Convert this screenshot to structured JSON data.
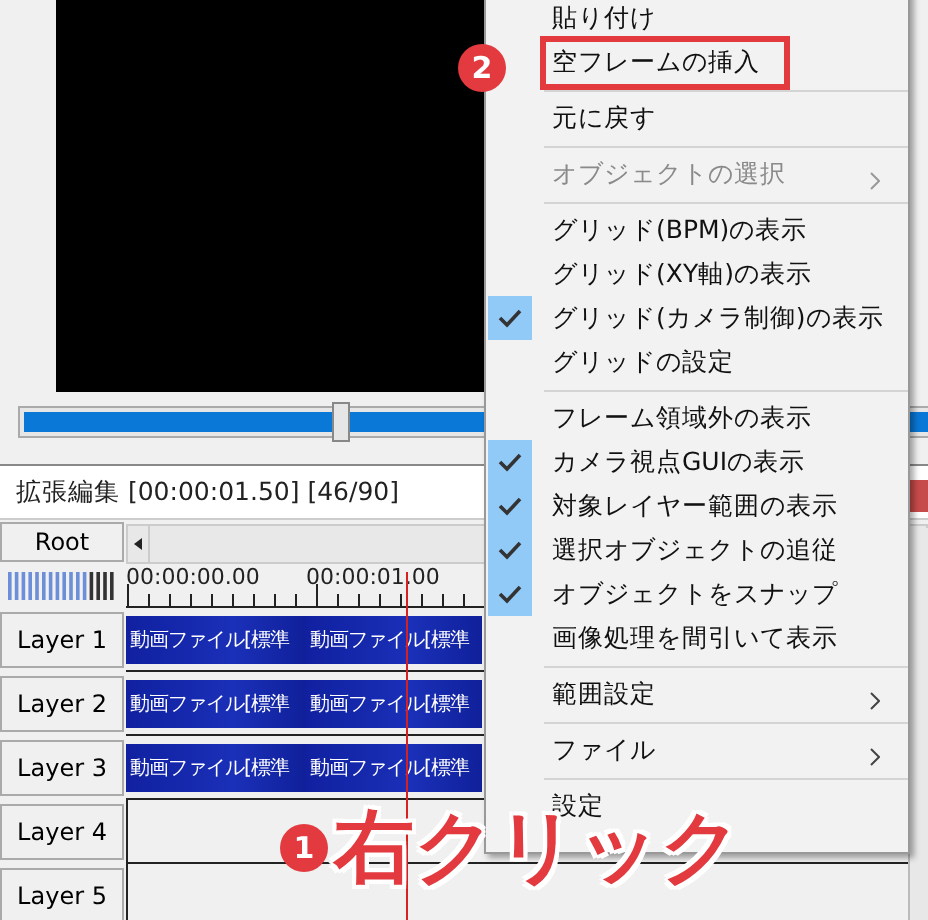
{
  "seek_slider": {
    "level": 0.35
  },
  "timeline": {
    "title": "拡張編集 [00:00:01.50] [46/90]",
    "root_button": "Root",
    "time_labels": [
      "00:00:00.00",
      "00:00:01.00"
    ],
    "layers": [
      {
        "name": "Layer 1",
        "clips": [
          "動画ファイル[標準",
          "動画ファイル[標準"
        ]
      },
      {
        "name": "Layer 2",
        "clips": [
          "動画ファイル[標準",
          "動画ファイル[標準"
        ]
      },
      {
        "name": "Layer 3",
        "clips": [
          "動画ファイル[標準",
          "動画ファイル[標準"
        ]
      },
      {
        "name": "Layer 4"
      },
      {
        "name": "Layer 5"
      }
    ]
  },
  "context_menu": {
    "items": [
      {
        "kind": "item",
        "label": "貼り付け",
        "checked": false,
        "disabled": false,
        "submenu": false,
        "highlighted": false
      },
      {
        "kind": "item",
        "label": "空フレームの挿入",
        "checked": false,
        "disabled": false,
        "submenu": false,
        "highlighted": true
      },
      {
        "kind": "separator"
      },
      {
        "kind": "item",
        "label": "元に戻す",
        "checked": false,
        "disabled": false,
        "submenu": false,
        "highlighted": false
      },
      {
        "kind": "separator"
      },
      {
        "kind": "item",
        "label": "オブジェクトの選択",
        "checked": false,
        "disabled": true,
        "submenu": true,
        "highlighted": false
      },
      {
        "kind": "separator"
      },
      {
        "kind": "item",
        "label": "グリッド(BPM)の表示",
        "checked": false,
        "disabled": false,
        "submenu": false,
        "highlighted": false
      },
      {
        "kind": "item",
        "label": "グリッド(XY軸)の表示",
        "checked": false,
        "disabled": false,
        "submenu": false,
        "highlighted": false
      },
      {
        "kind": "item",
        "label": "グリッド(カメラ制御)の表示",
        "checked": true,
        "disabled": false,
        "submenu": false,
        "highlighted": false
      },
      {
        "kind": "item",
        "label": "グリッドの設定",
        "checked": false,
        "disabled": false,
        "submenu": false,
        "highlighted": false
      },
      {
        "kind": "separator"
      },
      {
        "kind": "item",
        "label": "フレーム領域外の表示",
        "checked": false,
        "disabled": false,
        "submenu": false,
        "highlighted": false
      },
      {
        "kind": "item",
        "label": "カメラ視点GUIの表示",
        "checked": true,
        "disabled": false,
        "submenu": false,
        "highlighted": false
      },
      {
        "kind": "item",
        "label": "対象レイヤー範囲の表示",
        "checked": true,
        "disabled": false,
        "submenu": false,
        "highlighted": false
      },
      {
        "kind": "item",
        "label": "選択オブジェクトの追従",
        "checked": true,
        "disabled": false,
        "submenu": false,
        "highlighted": false
      },
      {
        "kind": "item",
        "label": "オブジェクトをスナップ",
        "checked": true,
        "disabled": false,
        "submenu": false,
        "highlighted": false
      },
      {
        "kind": "item",
        "label": "画像処理を間引いて表示",
        "checked": false,
        "disabled": false,
        "submenu": false,
        "highlighted": false
      },
      {
        "kind": "separator"
      },
      {
        "kind": "item",
        "label": "範囲設定",
        "checked": false,
        "disabled": false,
        "submenu": true,
        "highlighted": false
      },
      {
        "kind": "separator"
      },
      {
        "kind": "item",
        "label": "ファイル",
        "checked": false,
        "disabled": false,
        "submenu": true,
        "highlighted": false
      },
      {
        "kind": "separator"
      },
      {
        "kind": "item",
        "label": "設定",
        "checked": false,
        "disabled": false,
        "submenu": false,
        "highlighted": false
      }
    ]
  },
  "callouts": [
    {
      "badge": "2"
    },
    {
      "badge": "1",
      "text": "右クリック"
    }
  ]
}
